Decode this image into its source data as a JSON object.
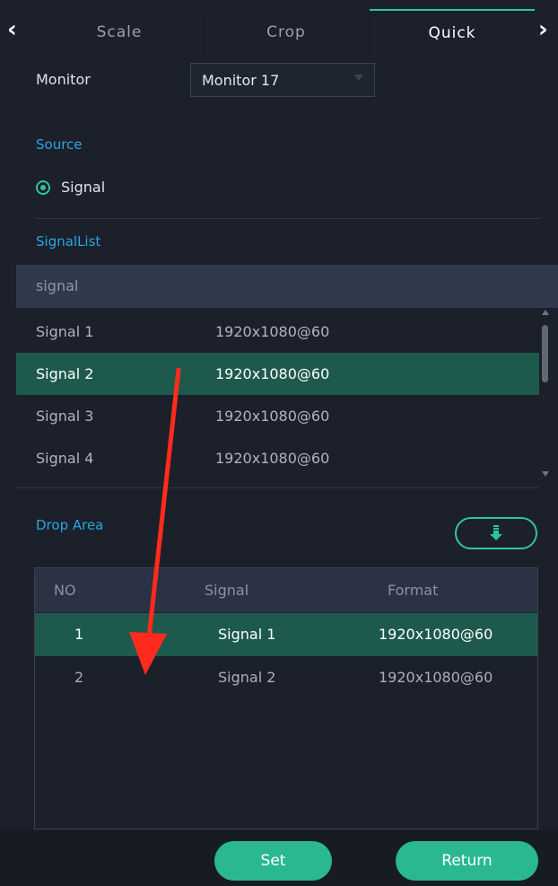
{
  "tabs": [
    {
      "label": "Scale",
      "active": false
    },
    {
      "label": "Crop",
      "active": false
    },
    {
      "label": "Quick",
      "active": true
    }
  ],
  "monitor": {
    "label": "Monitor",
    "value": "Monitor 17"
  },
  "source": {
    "section_label": "Source",
    "option": "Signal",
    "selected": true
  },
  "signal_list": {
    "section_label": "SignalList",
    "filter_text": "signal",
    "rows": [
      {
        "name": "Signal 1",
        "format": "1920x1080@60",
        "selected": false
      },
      {
        "name": "Signal 2",
        "format": "1920x1080@60",
        "selected": true
      },
      {
        "name": "Signal 3",
        "format": "1920x1080@60",
        "selected": false
      },
      {
        "name": "Signal 4",
        "format": "1920x1080@60",
        "selected": false
      }
    ]
  },
  "drop_area": {
    "section_label": "Drop Area",
    "columns": [
      "NO",
      "Signal",
      "Format"
    ],
    "rows": [
      {
        "no": "1",
        "signal": "Signal 1",
        "format": "1920x1080@60",
        "selected": true
      },
      {
        "no": "2",
        "signal": "Signal 2",
        "format": "1920x1080@60",
        "selected": false
      }
    ]
  },
  "buttons": {
    "set": "Set",
    "return": "Return"
  },
  "colors": {
    "accent": "#2ec4a0",
    "selected_row": "#1d5a4d",
    "section_text": "#27a8df",
    "annotation_arrow": "#ff2b1c"
  }
}
